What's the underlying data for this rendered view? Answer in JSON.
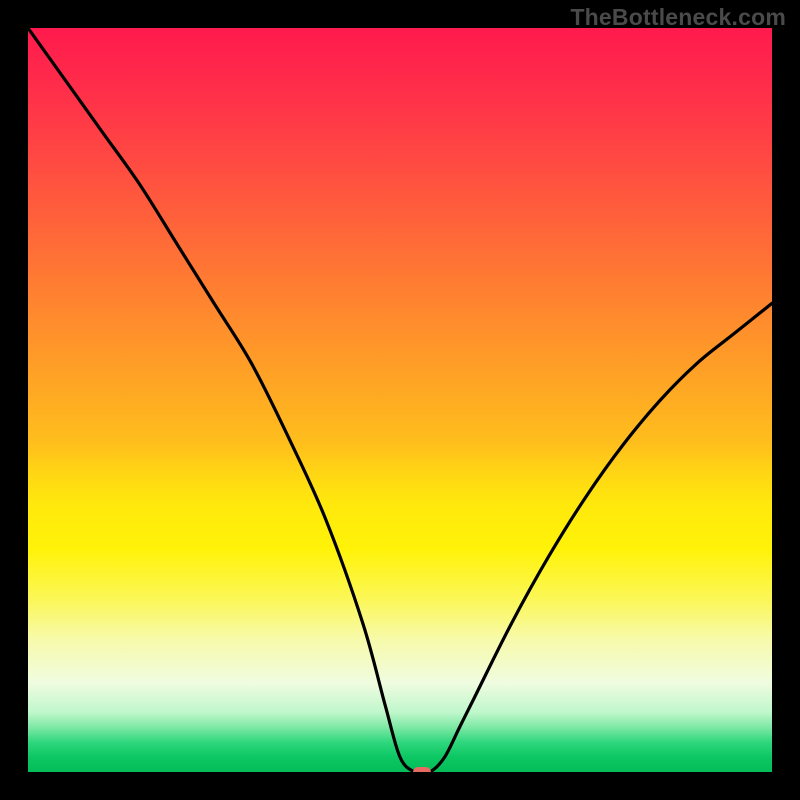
{
  "watermark": "TheBottleneck.com",
  "chart_data": {
    "type": "line",
    "title": "",
    "xlabel": "",
    "ylabel": "",
    "xlim": [
      0,
      100
    ],
    "ylim": [
      0,
      100
    ],
    "grid": false,
    "legend": false,
    "series": [
      {
        "name": "bottleneck-curve",
        "x": [
          0,
          5,
          10,
          15,
          20,
          25,
          30,
          35,
          40,
          45,
          48,
          50,
          52,
          54,
          56,
          58,
          60,
          65,
          70,
          75,
          80,
          85,
          90,
          95,
          100
        ],
        "y": [
          100,
          93,
          86,
          79,
          71,
          63,
          55,
          45,
          34,
          20,
          9,
          2,
          0,
          0,
          2,
          6,
          10,
          20,
          29,
          37,
          44,
          50,
          55,
          59,
          63
        ]
      }
    ],
    "marker": {
      "x": 53,
      "y": 0,
      "color": "#e66a62"
    },
    "background_gradient": {
      "stops": [
        {
          "pos": 0,
          "color": "#ff1a4d"
        },
        {
          "pos": 50,
          "color": "#ffa624"
        },
        {
          "pos": 70,
          "color": "#fff308"
        },
        {
          "pos": 92,
          "color": "#bff7cb"
        },
        {
          "pos": 100,
          "color": "#04bd59"
        }
      ]
    }
  }
}
